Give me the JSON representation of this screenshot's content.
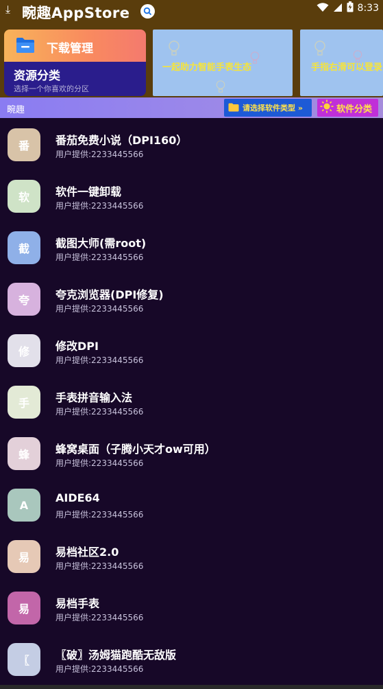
{
  "status_bar": {
    "download_glyph": "⤓",
    "app_title": "畹趣AppStore",
    "time": "8:33",
    "icons": [
      "download-icon",
      "search-icon",
      "wifi-icon",
      "signal-icon",
      "battery-icon"
    ]
  },
  "main_card": {
    "title": "下载管理",
    "subtitle": "资源分类",
    "description": "选择一个你喜欢的分区"
  },
  "banners": [
    {
      "text": "一起助力智能手表生态"
    },
    {
      "text": "手指右滑可以登录"
    }
  ],
  "category_bar": {
    "label": "畹趣",
    "type_button": "请选择软件类型 »",
    "category_button": "软件分类"
  },
  "apps": [
    {
      "initial": "番",
      "name": "番茄免费小说（DPI160）",
      "provider": "用户提供:2233445566",
      "color": "#d8c3a8"
    },
    {
      "initial": "软",
      "name": "软件一键卸载",
      "provider": "用户提供:2233445566",
      "color": "#cfe3c7"
    },
    {
      "initial": "截",
      "name": "截图大师(需root)",
      "provider": "用户提供:2233445566",
      "color": "#8fb0e8"
    },
    {
      "initial": "夸",
      "name": "夸克浏览器(DPI修复)",
      "provider": "用户提供:2233445566",
      "color": "#d7b2de"
    },
    {
      "initial": "修",
      "name": "修改DPI",
      "provider": "用户提供:2233445566",
      "color": "#e2e0ea"
    },
    {
      "initial": "手",
      "name": "手表拼音输入法",
      "provider": "用户提供:2233445566",
      "color": "#e3ead6"
    },
    {
      "initial": "蜂",
      "name": "蜂窝桌面（子腾小天才ow可用）",
      "provider": "用户提供:2233445566",
      "color": "#e3d0d9"
    },
    {
      "initial": "A",
      "name": "AIDE64",
      "provider": "用户提供:2233445566",
      "color": "#a9c7bd"
    },
    {
      "initial": "易",
      "name": "易档社区2.0",
      "provider": "用户提供:2233445566",
      "color": "#e6c9b6"
    },
    {
      "initial": "易",
      "name": "易档手表",
      "provider": "用户提供:2233445566",
      "color": "#c266a9"
    },
    {
      "initial": "〖",
      "name": "〖破〗汤姆猫跑酷无敌版",
      "provider": "用户提供:2233445566",
      "color": "#c4cde4"
    }
  ]
}
